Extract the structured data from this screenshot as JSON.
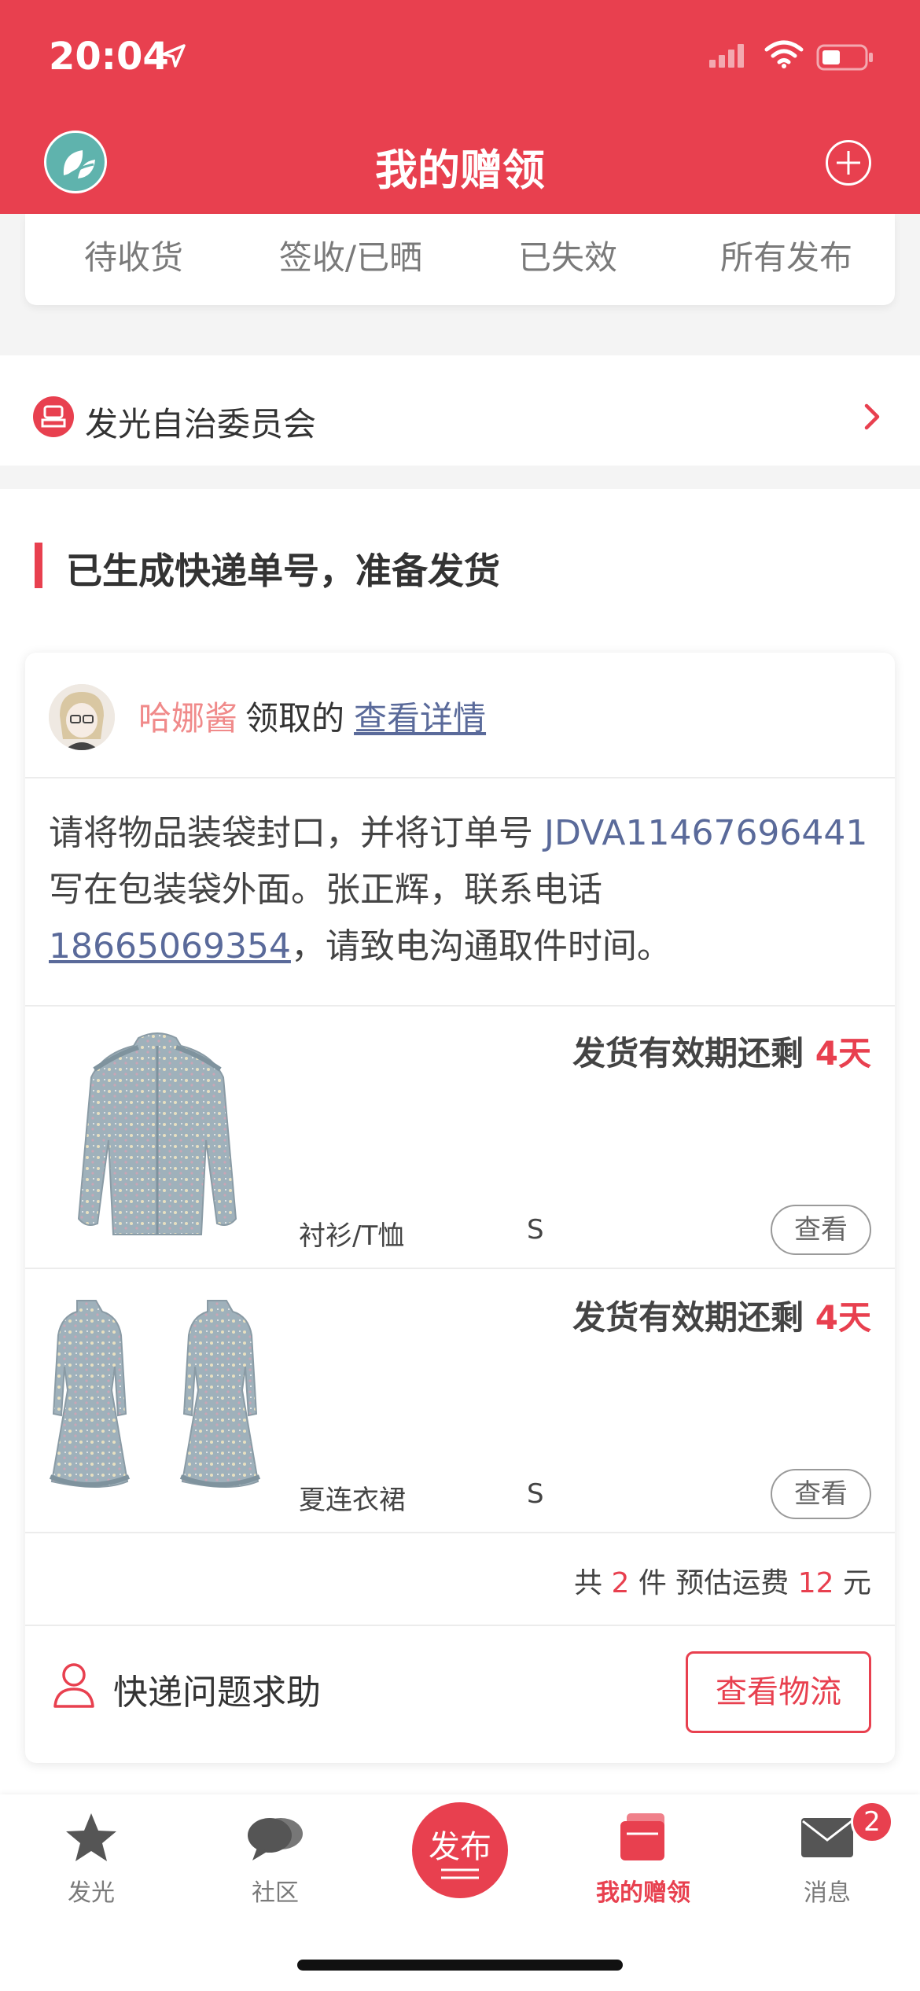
{
  "status_bar": {
    "time": "20:04"
  },
  "header": {
    "title": "我的赠领"
  },
  "order_tabs": [
    "待收货",
    "签收/已晒",
    "已失效",
    "所有发布"
  ],
  "committee": {
    "label": "发光自治委员会"
  },
  "section": {
    "title": "已生成快递单号，准备发货"
  },
  "order": {
    "claimant_name": "哈娜酱",
    "claimed_text": "领取的",
    "detail_link": "查看详情",
    "instructions": {
      "part1": "请将物品装袋封口，并将订单号 ",
      "tracking_no": "JDVA11467696441",
      "part2": " 写在包装袋外面。张正辉，联系电话",
      "phone": "18665069354",
      "part3": "，请致电沟通取件时间。"
    },
    "items": [
      {
        "deadline_label": "发货有效期还剩 ",
        "deadline_days": "4天",
        "category": "衬衫/T恤",
        "size": "S",
        "view_label": "查看"
      },
      {
        "deadline_label": "发货有效期还剩 ",
        "deadline_days": "4天",
        "category": "夏连衣裙",
        "size": "S",
        "view_label": "查看"
      }
    ],
    "summary": {
      "prefix": "共 ",
      "count": "2",
      "mid": " 件 预估运费 ",
      "fee": "12",
      "suffix": " 元"
    },
    "help_label": "快递问题求助",
    "track_button": "查看物流"
  },
  "bottom_nav": {
    "items": [
      {
        "label": "发光",
        "icon": "star-icon"
      },
      {
        "label": "社区",
        "icon": "chat-icon"
      },
      {
        "label": "发布",
        "icon": "publish-icon"
      },
      {
        "label": "我的赠领",
        "icon": "gift-cards-icon",
        "active": true
      },
      {
        "label": "消息",
        "icon": "mail-icon",
        "badge": "2"
      }
    ]
  },
  "colors": {
    "brand": "#e8404f",
    "link": "#5a6a9a",
    "name_pink": "#f08a8a"
  }
}
